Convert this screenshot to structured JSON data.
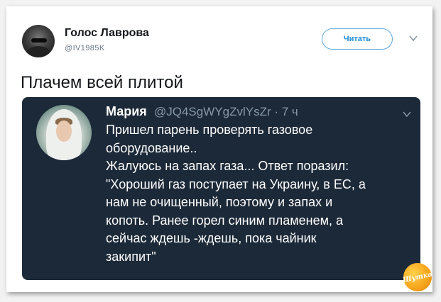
{
  "tweet": {
    "author_name": "Голос Лаврова",
    "author_handle": "@IV1985K",
    "follow_label": "Читать",
    "text": "Плачем всей плитой"
  },
  "quoted_tweet": {
    "author_name": "Мария",
    "author_handle": "@JQ4SgWYgZvlYsZr · 7 ч",
    "lines": [
      "Пришел парень проверять газовое",
      "оборудование..",
      "Жалуюсь на запах газа... Ответ поразил:",
      "\"Хороший газ поступает на Украину, в ЕС, а",
      "нам не очищенный, поэтому и запах и",
      "копоть. Ранее горел синим пламенем, а",
      "сейчас ждешь -ждешь, пока чайник",
      "закипит\""
    ]
  },
  "watermark": {
    "text": "Шутка"
  },
  "colors": {
    "accent": "#1d8cd6",
    "quote_background": "#1c2938",
    "muted_text": "#8899a6",
    "watermark": "#f5a31a"
  },
  "icons": {
    "more": "chevron-down-icon"
  }
}
